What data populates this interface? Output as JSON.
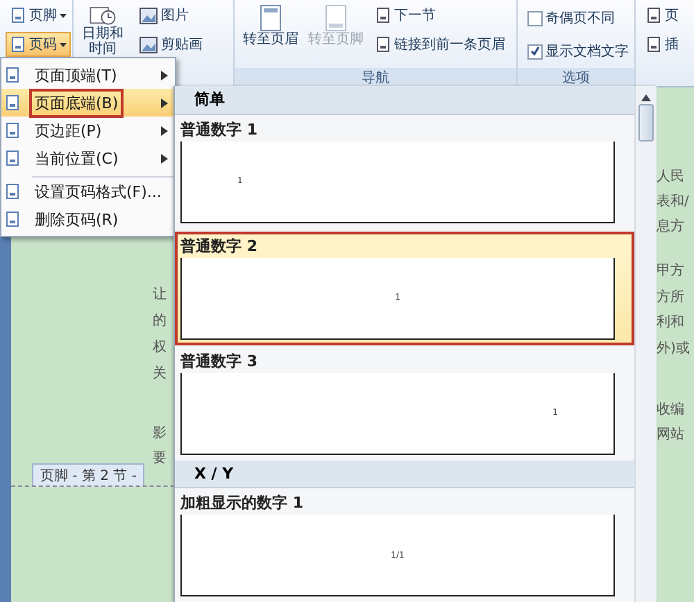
{
  "ribbon": {
    "header_footer": [
      {
        "label": "页脚",
        "selected": false
      },
      {
        "label": "页码",
        "selected": true
      }
    ],
    "date_button": {
      "lines": [
        "日期和",
        "时间"
      ]
    },
    "insert_buttons": [
      "图片",
      "剪贴画"
    ],
    "nav_big": [
      {
        "label": "转至页眉",
        "disabled": false
      },
      {
        "label": "转至页脚",
        "disabled": true
      }
    ],
    "nav_small": [
      "下一节",
      "链接到前一条页眉"
    ],
    "nav_label": "导航",
    "options": [
      {
        "label": "奇偶页不同",
        "checked": false
      },
      {
        "label": "显示文档文字",
        "checked": true
      }
    ],
    "options_label": "选项",
    "position": [
      "页",
      "插"
    ]
  },
  "menu": {
    "items": [
      {
        "label": "页面顶端(T)",
        "submenu": true,
        "selected": false
      },
      {
        "label": "页面底端(B)",
        "submenu": true,
        "selected": true
      },
      {
        "label": "页边距(P)",
        "submenu": true,
        "selected": false
      },
      {
        "label": "当前位置(C)",
        "submenu": true,
        "selected": false
      },
      {
        "label": "设置页码格式(F)...",
        "submenu": false,
        "selected": false,
        "separator": true
      },
      {
        "label": "删除页码(R)",
        "submenu": false,
        "selected": false
      }
    ]
  },
  "gallery": {
    "sections": [
      {
        "title": "简单",
        "items": [
          {
            "label": "普通数字 1",
            "number": "1",
            "kind": "left",
            "selected": false
          },
          {
            "label": "普通数字 2",
            "number": "1",
            "kind": "center",
            "selected": true
          },
          {
            "label": "普通数字 3",
            "number": "1",
            "kind": "right",
            "selected": false
          }
        ]
      },
      {
        "title": "X / Y",
        "items": [
          {
            "label": "加粗显示的数字 1",
            "number": "1/1",
            "kind": "center",
            "selected": false
          }
        ]
      }
    ]
  },
  "document": {
    "left_fragments": [
      "让",
      "的",
      "权",
      "关",
      "影",
      "要"
    ],
    "right_fragments": [
      "人民",
      "表和/",
      "息方",
      "甲方",
      "方所",
      "利和",
      "外)或",
      "收编",
      "网站"
    ],
    "footer_tab": "页脚 - 第 2 节 -"
  }
}
